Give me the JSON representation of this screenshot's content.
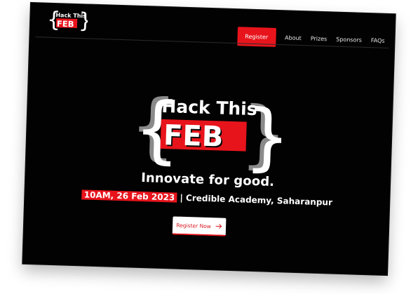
{
  "logo": {
    "line1": "Hack This",
    "line2": "FEB",
    "brace_open": "{",
    "brace_close": "}"
  },
  "nav": {
    "register_label": "Register",
    "links": [
      "About",
      "Prizes",
      "Sponsors",
      "FAQs"
    ]
  },
  "hero": {
    "tagline": "Innovate for good.",
    "date_time": "10AM, 26 Feb 2023",
    "separator": "|",
    "venue": "Credible Academy, Saharanpur",
    "cta_label": "Register Now",
    "cta_icon": "arrow-right-icon"
  },
  "colors": {
    "accent": "#e8141c",
    "background": "#020202",
    "text": "#ffffff"
  }
}
